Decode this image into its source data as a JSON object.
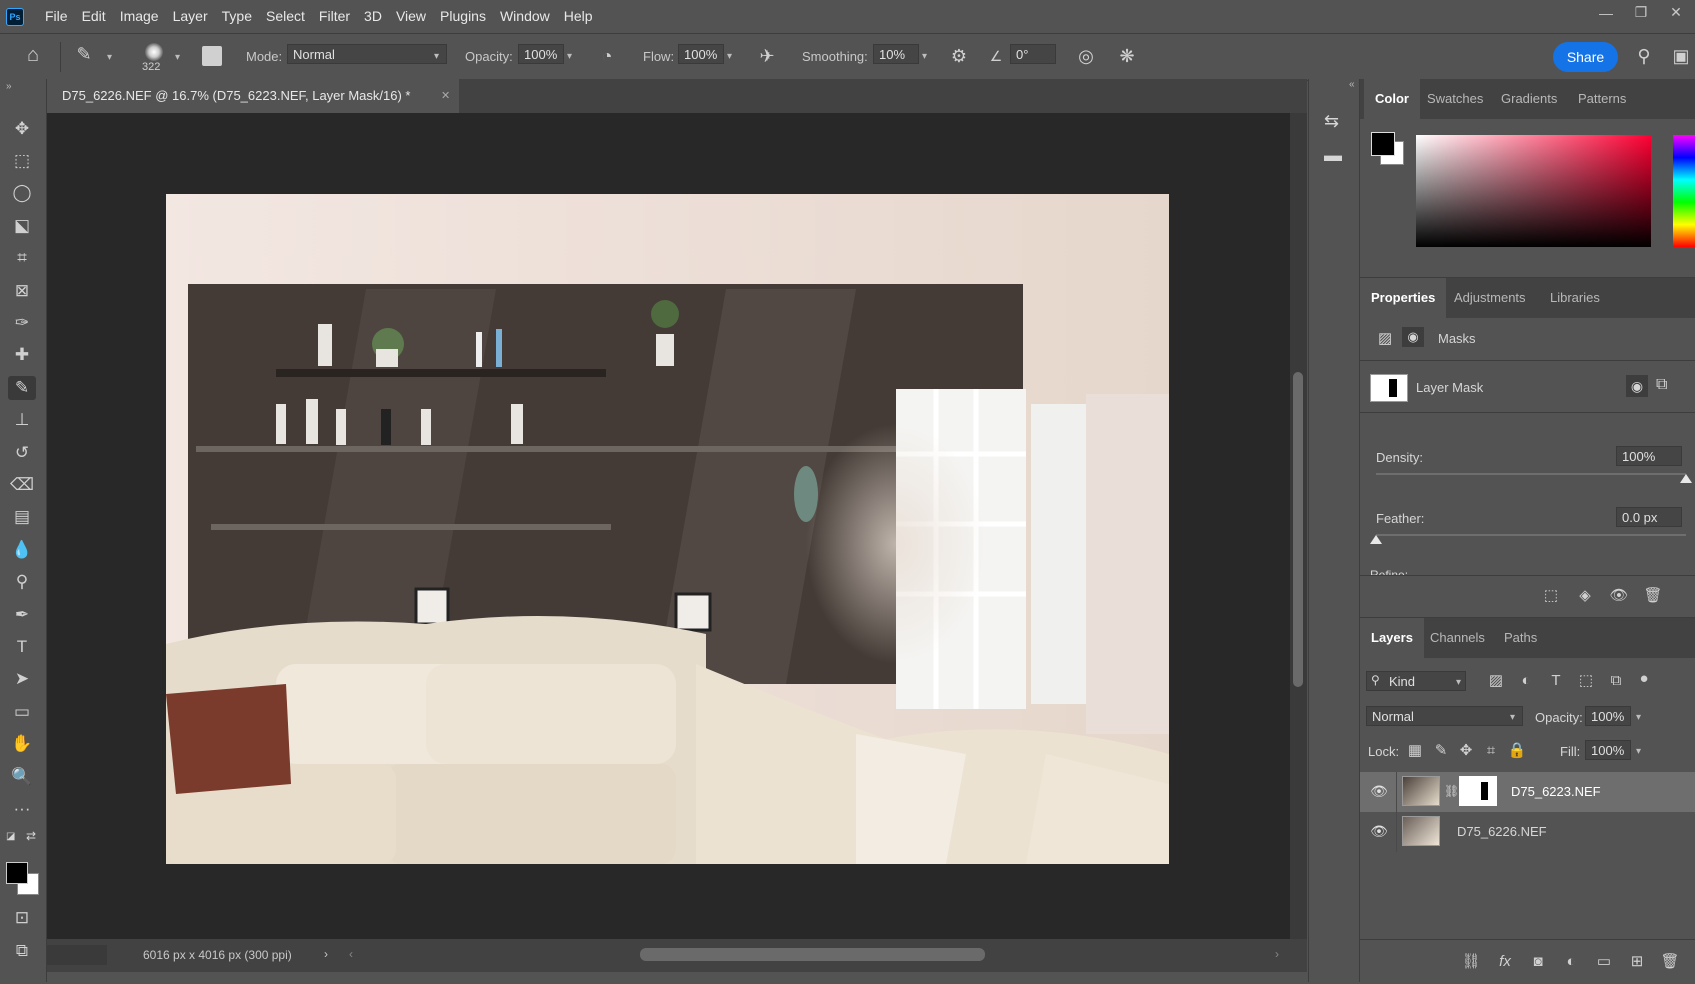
{
  "app": {
    "logo": "Ps"
  },
  "menu": [
    "File",
    "Edit",
    "Image",
    "Layer",
    "Type",
    "Select",
    "Filter",
    "3D",
    "View",
    "Plugins",
    "Window",
    "Help"
  ],
  "window_controls": {
    "minimize": "—",
    "maximize": "❐",
    "close": "✕"
  },
  "options_bar": {
    "brush_size": "322",
    "mode_label": "Mode:",
    "mode_value": "Normal",
    "opacity_label": "Opacity:",
    "opacity_value": "100%",
    "flow_label": "Flow:",
    "flow_value": "100%",
    "smoothing_label": "Smoothing:",
    "smoothing_value": "10%",
    "angle_value": "0°",
    "share_label": "Share"
  },
  "document": {
    "tab_title": "D75_6226.NEF @ 16.7% (D75_6223.NEF, Layer Mask/16) *",
    "close_glyph": "✕",
    "status_text": "6016 px x 4016 px (300 ppi)"
  },
  "color_panel": {
    "tabs": [
      "Color",
      "Swatches",
      "Gradients",
      "Patterns"
    ],
    "foreground": "#000000",
    "background": "#ffffff",
    "hue_color": "#ff0033"
  },
  "properties_panel": {
    "tabs": [
      "Properties",
      "Adjustments",
      "Libraries"
    ],
    "masks_label": "Masks",
    "layer_mask_label": "Layer Mask",
    "density_label": "Density:",
    "density_value": "100%",
    "density_level": 1.0,
    "feather_label": "Feather:",
    "feather_value": "0.0 px",
    "feather_level": 0.0,
    "refine_label": "Refine:"
  },
  "layers_panel": {
    "tabs": [
      "Layers",
      "Channels",
      "Paths"
    ],
    "filter_kind": "Kind",
    "blend_mode": "Normal",
    "opacity_label": "Opacity:",
    "opacity_value": "100%",
    "lock_label": "Lock:",
    "fill_label": "Fill:",
    "fill_value": "100%",
    "layers": [
      {
        "name": "D75_6223.NEF",
        "selected": true,
        "has_mask": true
      },
      {
        "name": "D75_6226.NEF",
        "selected": false,
        "has_mask": false
      }
    ]
  }
}
